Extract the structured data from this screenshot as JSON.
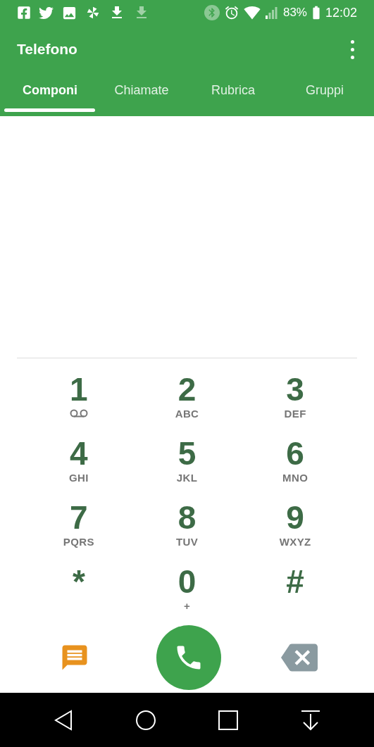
{
  "status_bar": {
    "battery": "83%",
    "time": "12:02"
  },
  "app_bar": {
    "title": "Telefono"
  },
  "tabs": [
    {
      "label": "Componi",
      "selected": true
    },
    {
      "label": "Chiamate",
      "selected": false
    },
    {
      "label": "Rubrica",
      "selected": false
    },
    {
      "label": "Gruppi",
      "selected": false
    }
  ],
  "keypad": [
    {
      "digit": "1",
      "kind": "voicemail"
    },
    {
      "digit": "2",
      "kind": "letters",
      "sub": "ABC"
    },
    {
      "digit": "3",
      "kind": "letters",
      "sub": "DEF"
    },
    {
      "digit": "4",
      "kind": "letters",
      "sub": "GHI"
    },
    {
      "digit": "5",
      "kind": "letters",
      "sub": "JKL"
    },
    {
      "digit": "6",
      "kind": "letters",
      "sub": "MNO"
    },
    {
      "digit": "7",
      "kind": "letters",
      "sub": "PQRS"
    },
    {
      "digit": "8",
      "kind": "letters",
      "sub": "TUV"
    },
    {
      "digit": "9",
      "kind": "letters",
      "sub": "WXYZ"
    },
    {
      "digit": "*",
      "kind": "plain"
    },
    {
      "digit": "0",
      "kind": "letters",
      "sub": "+"
    },
    {
      "digit": "#",
      "kind": "plain"
    }
  ]
}
